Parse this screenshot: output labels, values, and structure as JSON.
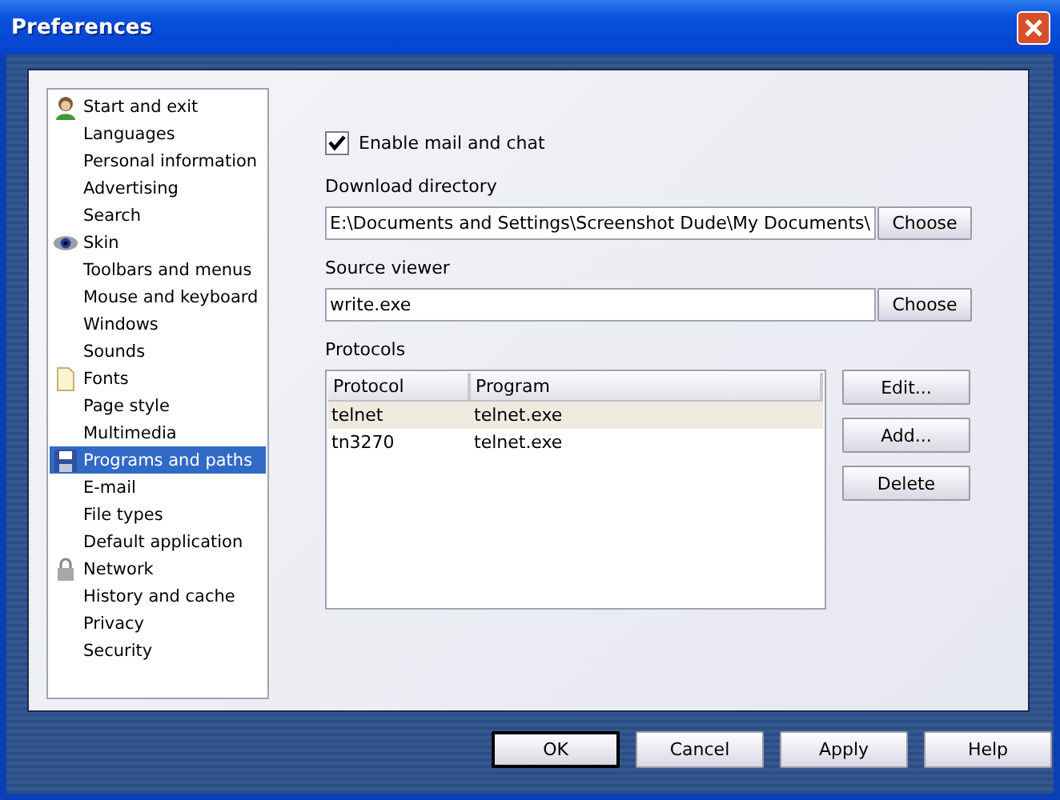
{
  "window": {
    "title": "Preferences"
  },
  "sidebar": {
    "sections": [
      {
        "label": "Start and exit",
        "selected": false,
        "children": [
          {
            "label": "Languages",
            "selected": false
          },
          {
            "label": "Personal information",
            "selected": false
          },
          {
            "label": "Advertising",
            "selected": false
          },
          {
            "label": "Search",
            "selected": false
          }
        ]
      },
      {
        "label": "Skin",
        "selected": false,
        "children": [
          {
            "label": "Toolbars and menus",
            "selected": false
          },
          {
            "label": "Mouse and keyboard",
            "selected": false
          },
          {
            "label": "Windows",
            "selected": false
          },
          {
            "label": "Sounds",
            "selected": false
          }
        ]
      },
      {
        "label": "Fonts",
        "selected": false,
        "children": [
          {
            "label": "Page style",
            "selected": false
          },
          {
            "label": "Multimedia",
            "selected": false
          }
        ]
      },
      {
        "label": "Programs and paths",
        "selected": true,
        "children": [
          {
            "label": "E-mail",
            "selected": false
          },
          {
            "label": "File types",
            "selected": false
          },
          {
            "label": "Default application",
            "selected": false
          }
        ]
      },
      {
        "label": "Network",
        "selected": false,
        "children": [
          {
            "label": "History and cache",
            "selected": false
          },
          {
            "label": "Privacy",
            "selected": false
          },
          {
            "label": "Security",
            "selected": false
          }
        ]
      }
    ]
  },
  "enable_mail": {
    "label": "Enable mail and chat",
    "checked": true
  },
  "download_directory": {
    "label": "Download directory",
    "value": "E:\\Documents and Settings\\Screenshot Dude\\My Documents\\",
    "button": "Choose"
  },
  "source_viewer": {
    "label": "Source viewer",
    "value": "write.exe",
    "button": "Choose"
  },
  "protocols": {
    "label": "Protocols",
    "columns": [
      "Protocol",
      "Program"
    ],
    "rows": [
      {
        "cells": [
          "telnet",
          "telnet.exe"
        ],
        "selected": true
      },
      {
        "cells": [
          "tn3270",
          "telnet.exe"
        ],
        "selected": false
      }
    ],
    "buttons": [
      "Edit...",
      "Add...",
      "Delete"
    ]
  },
  "footer_buttons": [
    {
      "label": "OK",
      "default": true
    },
    {
      "label": "Cancel",
      "default": false
    },
    {
      "label": "Apply",
      "default": false
    },
    {
      "label": "Help",
      "default": false
    }
  ]
}
